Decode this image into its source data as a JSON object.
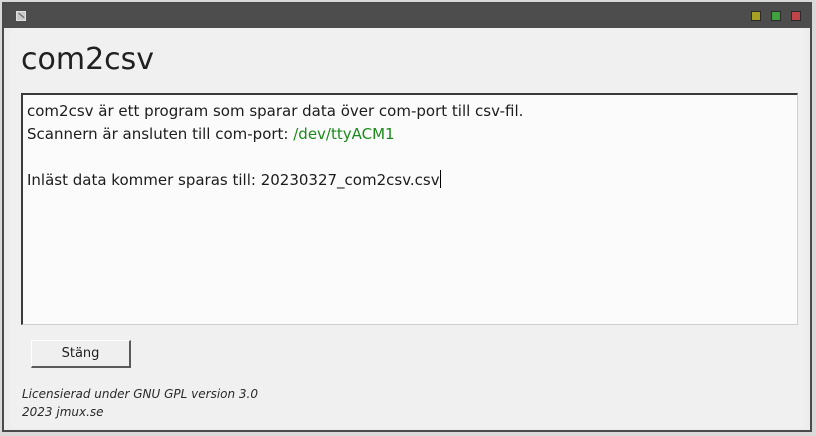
{
  "window": {
    "app_icon": "app-icon",
    "buttons": {
      "minimize_color": "#a5a021",
      "maximize_color": "#3fa23f",
      "close_color": "#c2454b"
    }
  },
  "app": {
    "title": "com2csv"
  },
  "output": {
    "line1": "com2csv är ett program som sparar data över com-port till csv-fil.",
    "line2_label": "Scannern är ansluten till com-port: ",
    "line2_value": "/dev/ttyACM1",
    "line4": "Inläst data kommer sparas till: 20230327_com2csv.csv",
    "port_color": "#1a8a1a"
  },
  "actions": {
    "close_label": "Stäng"
  },
  "footer": {
    "license": "Licensierad under GNU GPL version 3.0",
    "copyright": "2023 jmux.se"
  }
}
